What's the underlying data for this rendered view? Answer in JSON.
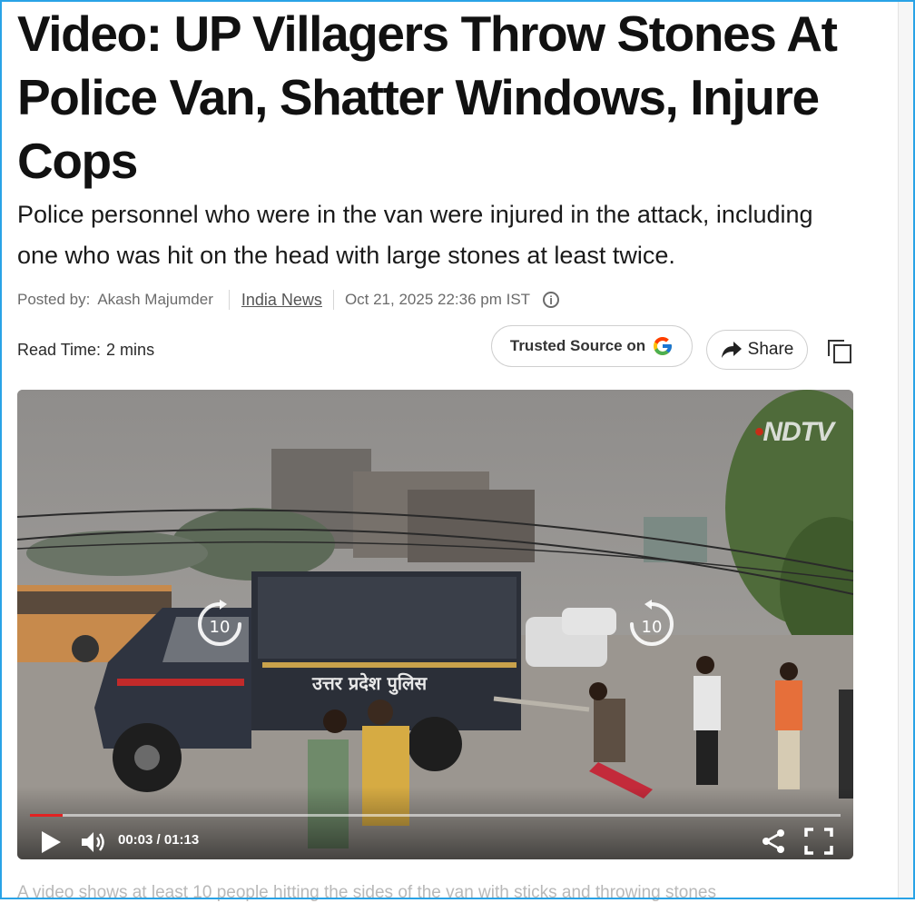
{
  "article": {
    "title": "Video: UP Villagers Throw Stones At Police Van, Shatter Windows, Injure Cops",
    "subtitle": "Police personnel who were in the van were injured in the attack, including one who was hit on the head with large stones at least twice.",
    "meta": {
      "posted_by_label": "Posted by:",
      "author": "Akash Majumder",
      "category": "India News",
      "datetime": "Oct 21, 2025 22:36 pm IST",
      "info_icon": "info-icon"
    },
    "read_time": {
      "label": "Read Time:",
      "value": "2 mins"
    },
    "trusted_source": {
      "label": "Trusted Source on",
      "logo": "google-g-logo"
    },
    "share": {
      "label": "Share",
      "icon": "share-arrow-icon"
    },
    "copy_icon": "copy-icon",
    "caption": "A video shows at least 10 people hitting the sides of the van with sticks and throwing stones"
  },
  "video": {
    "brand": "NDTV",
    "van_text": "उत्तर प्रदेश पुलिस",
    "seek_back_label": "10",
    "seek_forward_label": "10",
    "current_time": "00:03",
    "duration": "01:13",
    "time_display": "00:03 / 01:13",
    "progress_fraction": 0.04,
    "accent_color": "#e22222",
    "icons": [
      "play-icon",
      "volume-icon",
      "share-icon",
      "fullscreen-icon",
      "rewind-10-icon",
      "forward-10-icon"
    ]
  }
}
